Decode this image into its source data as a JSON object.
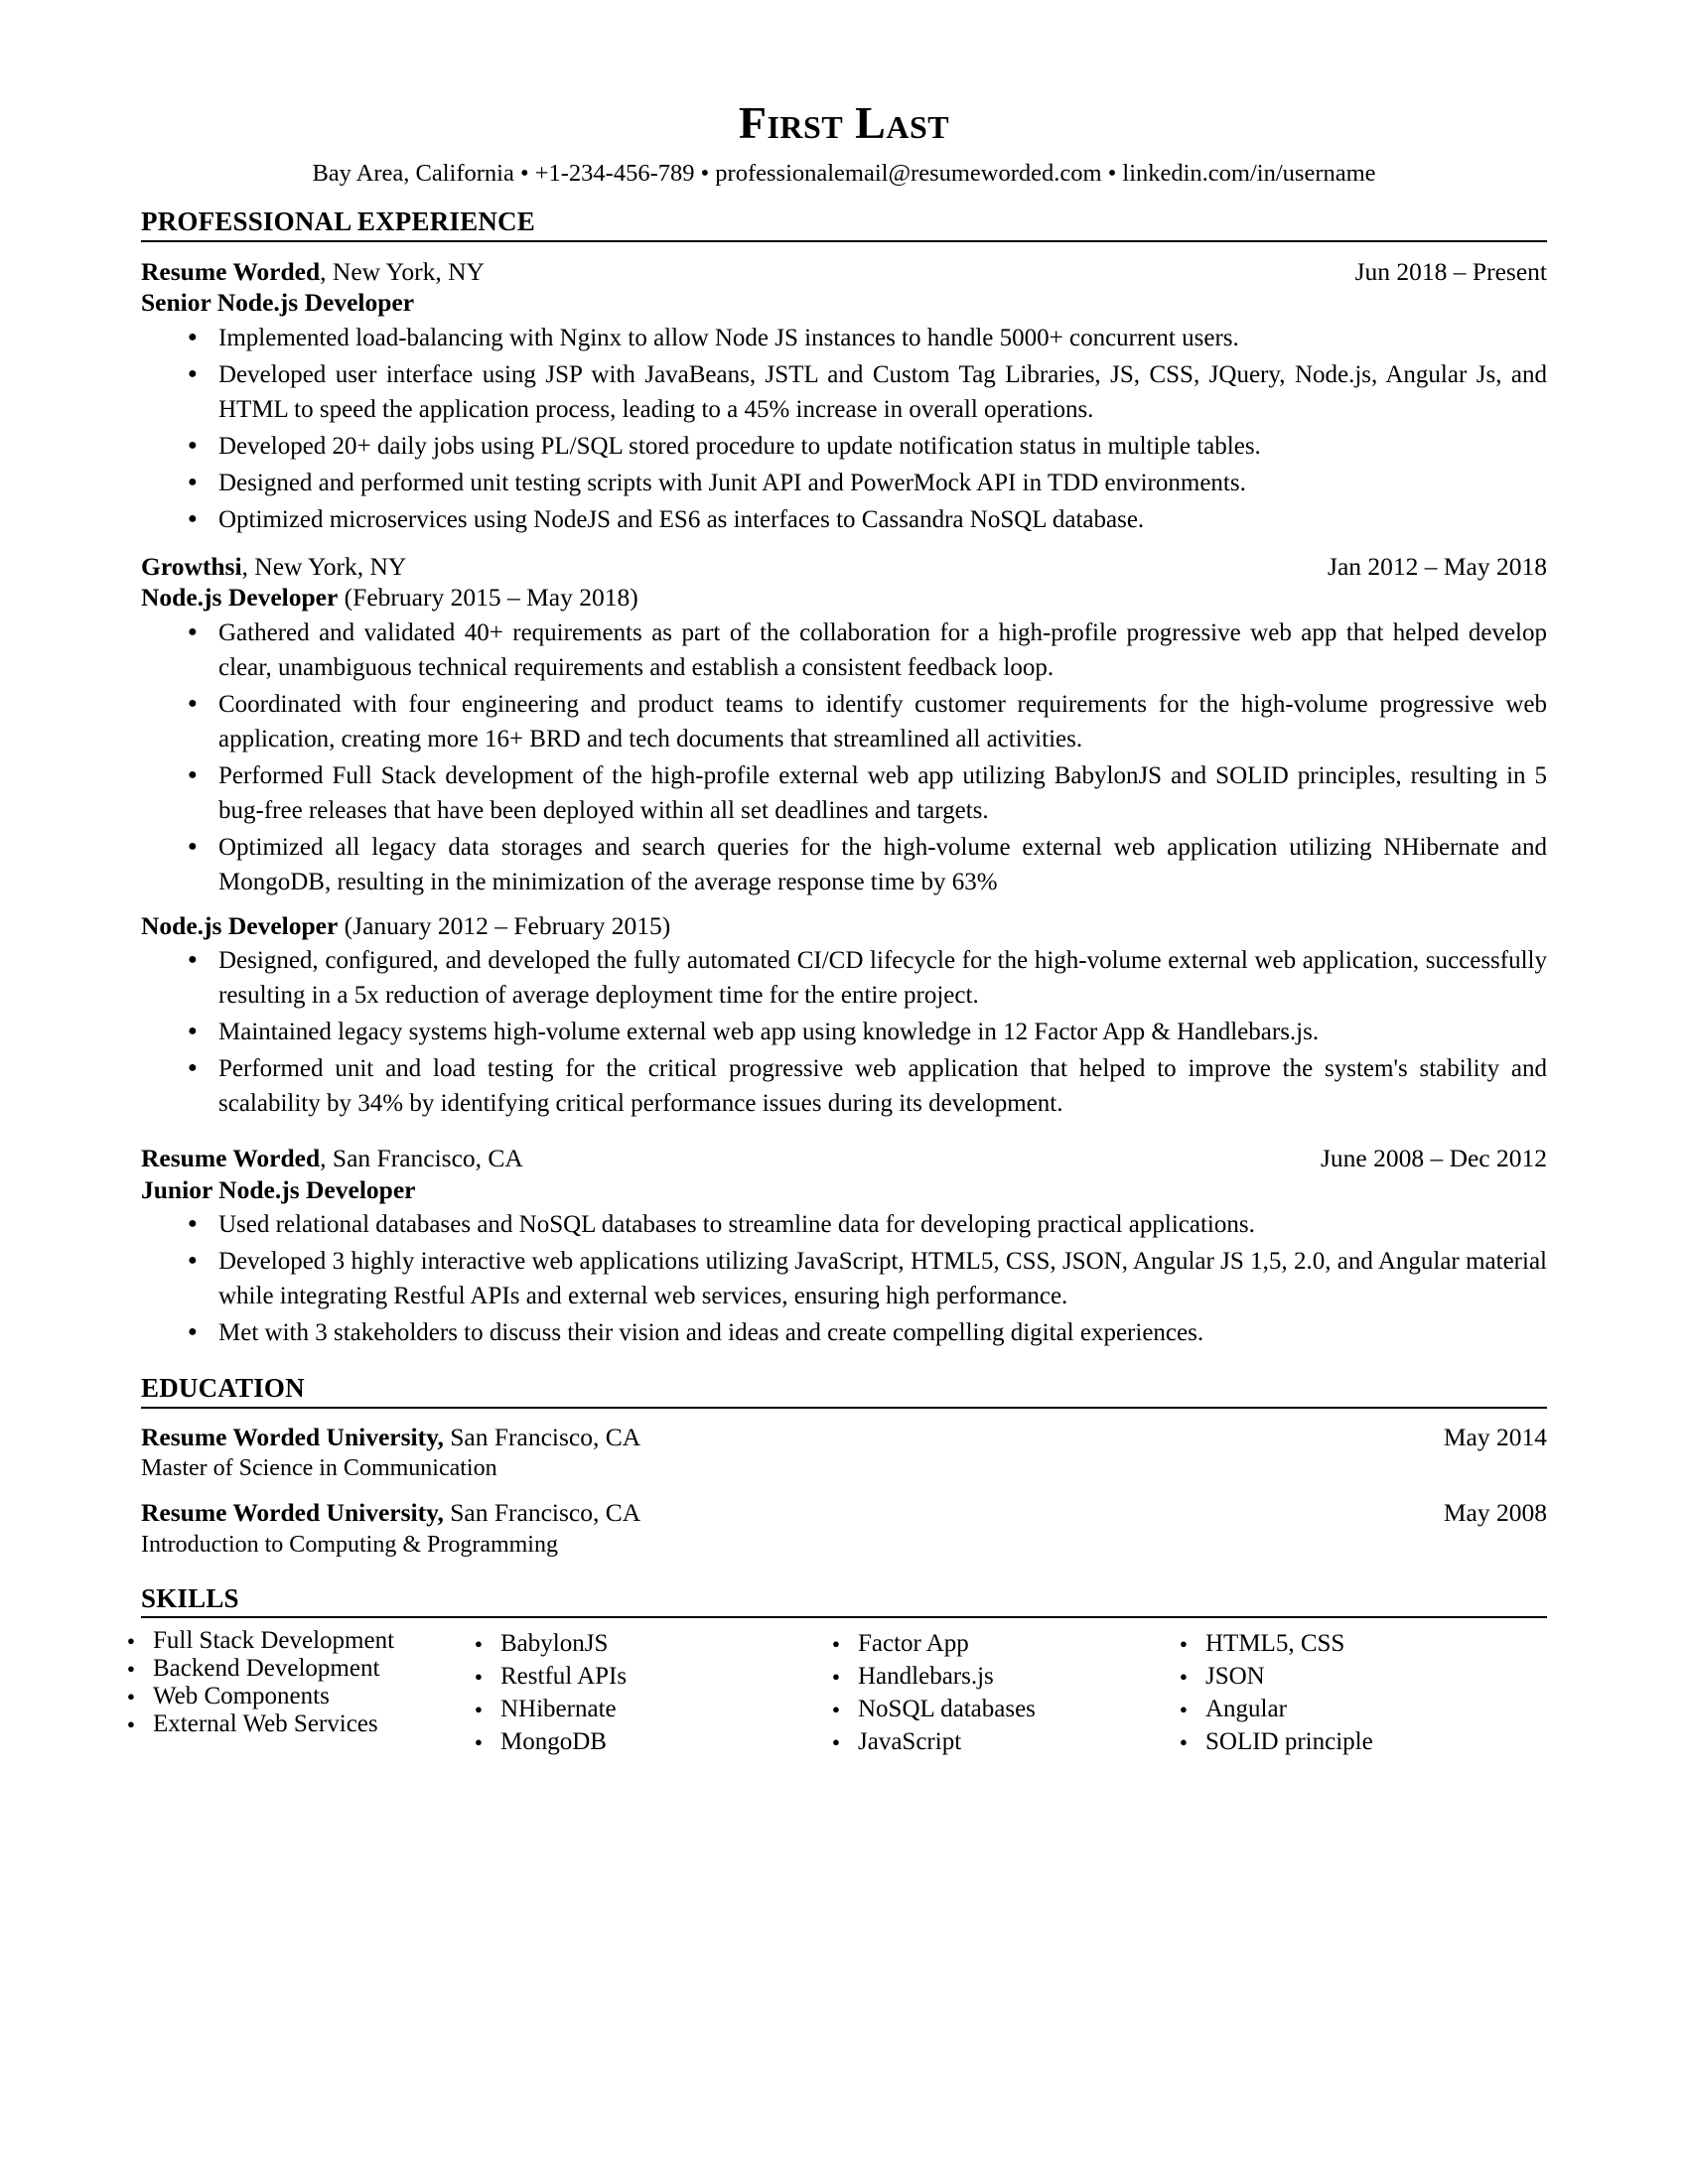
{
  "header": {
    "name": "First Last",
    "contact": "Bay Area, California • +1-234-456-789 • professionalemail@resumeworded.com • linkedin.com/in/username"
  },
  "sections": {
    "experience_title": "PROFESSIONAL EXPERIENCE",
    "education_title": "EDUCATION",
    "skills_title": "SKILLS"
  },
  "experience": [
    {
      "company": "Resume Worded",
      "location": ", New York, NY",
      "dates": "Jun 2018 – Present",
      "role": "Senior Node.js Developer",
      "role_dates": "",
      "bullets": [
        "Implemented load-balancing with Nginx to allow Node JS instances to handle 5000+ concurrent users.",
        "Developed user interface using JSP with JavaBeans, JSTL and Custom Tag Libraries, JS, CSS, JQuery, Node.js, Angular Js, and HTML to speed the application process, leading to a 45% increase in overall operations.",
        "Developed 20+ daily jobs using PL/SQL stored procedure to update notification status in multiple tables.",
        "Designed and performed unit testing scripts with Junit API and PowerMock API in TDD environments.",
        "Optimized microservices using NodeJS and ES6 as interfaces to Cassandra NoSQL database."
      ]
    },
    {
      "company": "Growthsi",
      "location": ", New York, NY",
      "dates": "Jan 2012 – May 2018",
      "role": "Node.js Developer",
      "role_dates": " (February  2015 – May 2018)",
      "bullets": [
        "Gathered and validated 40+ requirements as part of the collaboration for a high-profile progressive web app that helped develop clear, unambiguous technical requirements and establish a consistent feedback loop.",
        "Coordinated with four engineering and product teams to identify customer requirements for the high-volume progressive web application, creating more 16+ BRD and tech documents that streamlined all activities.",
        "Performed Full Stack development of the high-profile external web app utilizing BabylonJS and SOLID principles, resulting in 5 bug-free releases that have been deployed within all set deadlines and targets.",
        "Optimized all legacy data storages and search queries for the high-volume external web application utilizing NHibernate and MongoDB, resulting in the minimization of the average response time by 63%"
      ]
    }
  ],
  "experience_subrole": {
    "role": "Node.js Developer",
    "role_dates": " (January 2012 – February 2015)",
    "bullets": [
      "Designed, configured, and developed the fully automated CI/CD lifecycle for the high-volume external web application, successfully resulting in a 5x reduction of average deployment time for the entire project.",
      "Maintained legacy systems high-volume external web app using knowledge in 12 Factor App & Handlebars.js.",
      "Performed unit and load testing for the critical progressive web application that helped to improve the system's stability and scalability by 34% by identifying critical performance issues during its development."
    ]
  },
  "experience_last": {
    "company": "Resume Worded",
    "location": ", San Francisco, CA",
    "dates": "June 2008 – Dec 2012",
    "role": "Junior Node.js Developer",
    "bullets": [
      "Used relational databases and NoSQL databases to streamline data for developing practical applications.",
      "Developed 3 highly interactive web applications utilizing JavaScript, HTML5, CSS, JSON, Angular JS 1,5, 2.0, and Angular material while integrating Restful APIs and external web services, ensuring high performance.",
      "Met with 3 stakeholders to discuss their vision and ideas and create compelling digital experiences."
    ]
  },
  "education": [
    {
      "school": "Resume Worded University,",
      "location": " San Francisco, CA",
      "date": "May 2014",
      "degree": "Master of Science in Communication"
    },
    {
      "school": "Resume Worded University,",
      "location": " San Francisco, CA",
      "date": "May 2008",
      "degree": "Introduction to Computing & Programming"
    }
  ],
  "skills": {
    "columns": [
      [
        "Full Stack Development",
        "Backend Development",
        "Web Components",
        "External Web Services"
      ],
      [
        "BabylonJS",
        "Restful APIs",
        "NHibernate",
        "MongoDB"
      ],
      [
        "Factor App",
        "Handlebars.js",
        "NoSQL databases",
        "JavaScript"
      ],
      [
        "HTML5, CSS",
        "JSON",
        "Angular",
        "SOLID principle"
      ]
    ]
  }
}
